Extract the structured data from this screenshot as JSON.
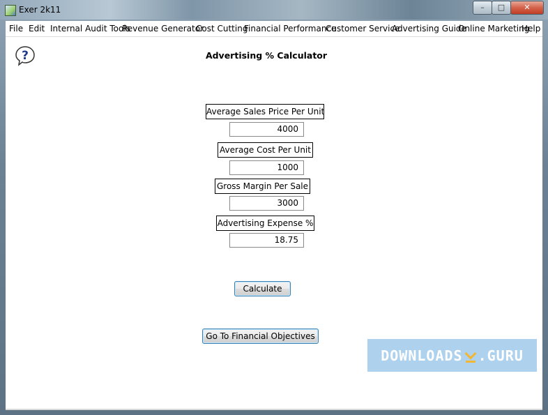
{
  "window": {
    "title": "Exer 2k11",
    "controls": {
      "minimize": "–",
      "maximize": "□",
      "close": "✕"
    }
  },
  "menu": [
    {
      "label": "File"
    },
    {
      "label": "Edit"
    },
    {
      "label": "Internal Audit Tools"
    },
    {
      "label": "Revenue Generator"
    },
    {
      "label": "Cost Cutting"
    },
    {
      "label": "Financial Performance"
    },
    {
      "label": "Customer Service"
    },
    {
      "label": "Advertising Guide"
    },
    {
      "label": "Online Marketing"
    },
    {
      "label": "Help"
    }
  ],
  "page": {
    "heading": "Advertising % Calculator",
    "help_icon": "question-mark-speech-bubble-icon",
    "fields": [
      {
        "label": "Average Sales Price Per Unit",
        "value": "4000"
      },
      {
        "label": "Average Cost Per Unit",
        "value": "1000"
      },
      {
        "label": "Gross Margin Per Sale",
        "value": "3000"
      },
      {
        "label": "Advertising Expense %",
        "value": "18.75"
      }
    ],
    "calculate_button": "Calculate",
    "objectives_button": "Go To Financial Objectives"
  },
  "watermark": {
    "left": "DOWNLOADS",
    "right": ".GURU"
  }
}
